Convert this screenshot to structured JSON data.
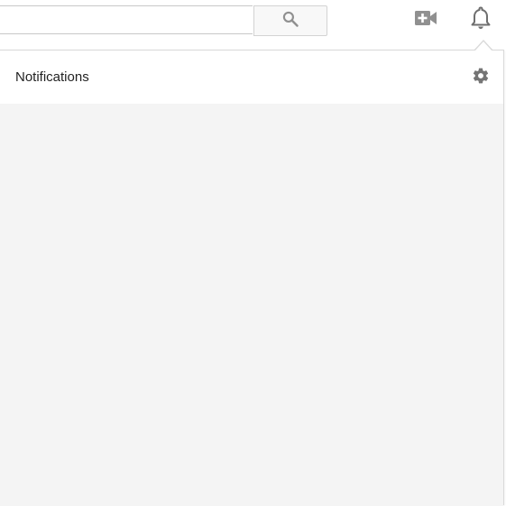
{
  "search": {
    "value": "",
    "placeholder": ""
  },
  "topbar": {
    "search_button_icon": "search-icon",
    "upload_icon": "video-add-icon",
    "notifications_icon": "bell-icon"
  },
  "notifications_panel": {
    "title": "Notifications",
    "settings_icon": "gear-icon"
  },
  "colors": {
    "icon": "#909090",
    "panel_background": "#f4f4f4",
    "header_background": "#ffffff",
    "title_text": "#222222"
  }
}
